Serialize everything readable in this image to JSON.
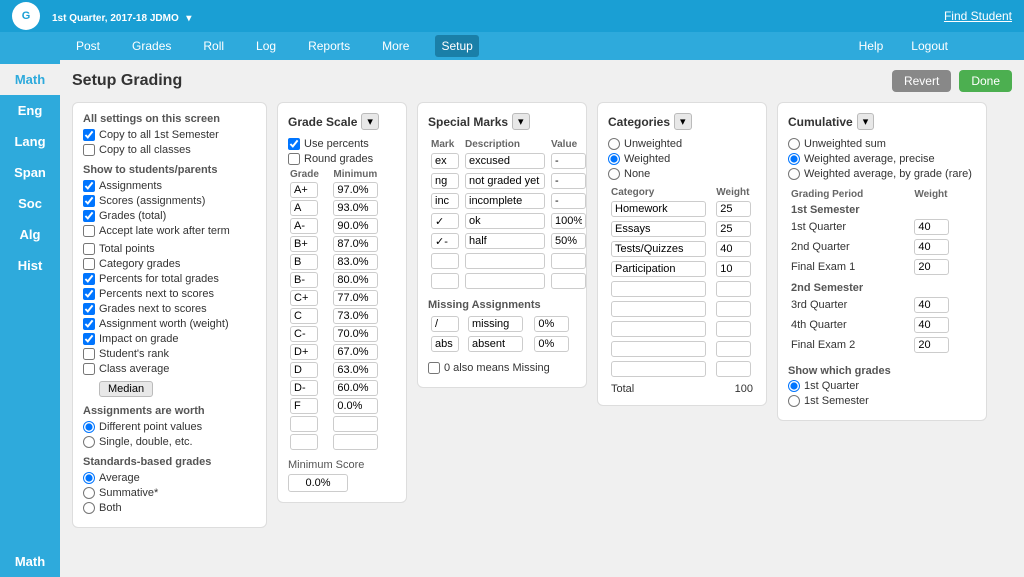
{
  "header": {
    "quarter": "1st Quarter, 2017-18 JDMO",
    "find_student": "Find Student",
    "logo": "G"
  },
  "nav": {
    "items": [
      "Post",
      "Grades",
      "Roll",
      "Log",
      "Reports",
      "More",
      "Setup"
    ],
    "active": "Setup",
    "right": [
      "Help",
      "Logout"
    ]
  },
  "sidebar": {
    "items": [
      "Math",
      "Eng",
      "Lang",
      "Span",
      "Soc",
      "Alg",
      "Hist",
      "Math"
    ],
    "active": "Math"
  },
  "page": {
    "title": "Setup Grading",
    "revert": "Revert",
    "done": "Done"
  },
  "settings_panel": {
    "title": "All settings on this screen",
    "copy1": "Copy to all 1st Semester",
    "copy2": "Copy to all classes",
    "show_label": "Show to students/parents",
    "show_items": [
      "Assignments",
      "Scores (assignments)",
      "Grades (total)",
      "Accept late work after term"
    ],
    "show_checked": [
      true,
      true,
      true,
      false
    ],
    "other_items": [
      "Total points",
      "Category grades",
      "Percents for total grades",
      "Percents next to scores",
      "Grades next to scores",
      "Assignment worth (weight)",
      "Impact on grade",
      "Student's rank",
      "Class average"
    ],
    "other_checked": [
      false,
      false,
      true,
      true,
      true,
      true,
      true,
      false,
      false
    ],
    "class_avg_option": "Median",
    "worth_label": "Assignments are worth",
    "worth_options": [
      "Different point values",
      "Single, double, etc."
    ],
    "worth_selected": 0,
    "standards_label": "Standards-based grades",
    "standards_options": [
      "Average",
      "Summative*",
      "Both"
    ],
    "standards_selected": 0
  },
  "grade_scale_panel": {
    "title": "Grade Scale",
    "use_percents": true,
    "round_grades": false,
    "grades": [
      {
        "grade": "A+",
        "min": "97.0%"
      },
      {
        "grade": "A",
        "min": "93.0%"
      },
      {
        "grade": "A-",
        "min": "90.0%"
      },
      {
        "grade": "B+",
        "min": "87.0%"
      },
      {
        "grade": "B",
        "min": "83.0%"
      },
      {
        "grade": "B-",
        "min": "80.0%"
      },
      {
        "grade": "C+",
        "min": "77.0%"
      },
      {
        "grade": "C",
        "min": "73.0%"
      },
      {
        "grade": "C-",
        "min": "70.0%"
      },
      {
        "grade": "D+",
        "min": "67.0%"
      },
      {
        "grade": "D",
        "min": "63.0%"
      },
      {
        "grade": "D-",
        "min": "60.0%"
      },
      {
        "grade": "F",
        "min": "0.0%"
      },
      {
        "grade": "",
        "min": ""
      },
      {
        "grade": "",
        "min": ""
      }
    ],
    "min_score_label": "Minimum Score",
    "min_score": "0.0%"
  },
  "special_marks_panel": {
    "title": "Special Marks",
    "headers": [
      "Mark",
      "Description",
      "Value"
    ],
    "marks": [
      {
        "mark": "ex",
        "desc": "excused",
        "value": "-"
      },
      {
        "mark": "ng",
        "desc": "not graded yet",
        "value": "-"
      },
      {
        "mark": "inc",
        "desc": "incomplete",
        "value": "-"
      },
      {
        "mark": "✓",
        "desc": "ok",
        "value": "100%"
      },
      {
        "mark": "✓-",
        "desc": "half",
        "value": "50%"
      },
      {
        "mark": "",
        "desc": "",
        "value": ""
      },
      {
        "mark": "",
        "desc": "",
        "value": ""
      }
    ],
    "missing_label": "Missing Assignments",
    "missing_marks": [
      {
        "mark": "/",
        "desc": "missing",
        "value": "0%"
      },
      {
        "mark": "abs",
        "desc": "absent",
        "value": "0%"
      }
    ],
    "zero_means_missing": false,
    "zero_label": "0 also means Missing"
  },
  "categories_panel": {
    "title": "Categories",
    "options": [
      "Unweighted",
      "Weighted",
      "None"
    ],
    "selected": "Weighted",
    "headers": [
      "Category",
      "Weight"
    ],
    "categories": [
      {
        "name": "Homework",
        "weight": "25"
      },
      {
        "name": "Essays",
        "weight": "25"
      },
      {
        "name": "Tests/Quizzes",
        "weight": "40"
      },
      {
        "name": "Participation",
        "weight": "10"
      },
      {
        "name": "",
        "weight": ""
      },
      {
        "name": "",
        "weight": ""
      },
      {
        "name": "",
        "weight": ""
      },
      {
        "name": "",
        "weight": ""
      },
      {
        "name": "",
        "weight": ""
      }
    ],
    "total_label": "Total",
    "total": "100"
  },
  "cumulative_panel": {
    "title": "Cumulative",
    "options": [
      "Unweighted sum",
      "Weighted average, precise",
      "Weighted average, by grade (rare)"
    ],
    "selected": "Weighted average, precise",
    "grading_period_label": "Grading Period",
    "weight_label": "Weight",
    "1st_semester_label": "1st Semester",
    "periods_1st": [
      {
        "period": "1st Quarter",
        "weight": "40"
      },
      {
        "period": "2nd Quarter",
        "weight": "40"
      },
      {
        "period": "Final Exam 1",
        "weight": "20"
      }
    ],
    "2nd_semester_label": "2nd Semester",
    "periods_2nd": [
      {
        "period": "3rd Quarter",
        "weight": "40"
      },
      {
        "period": "4th Quarter",
        "weight": "40"
      },
      {
        "period": "Final Exam 2",
        "weight": "20"
      }
    ],
    "show_grades_label": "Show which grades",
    "show_options": [
      "1st Quarter",
      "1st Semester"
    ],
    "show_selected": "1st Quarter"
  }
}
